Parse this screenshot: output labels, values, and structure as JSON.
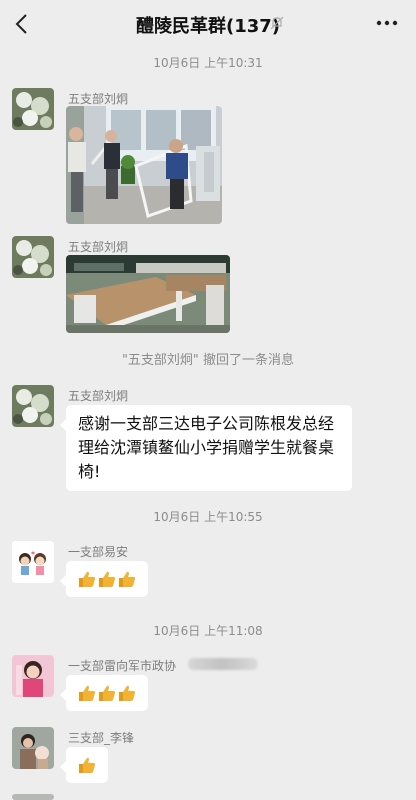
{
  "header": {
    "title": "醴陵民革群(137)"
  },
  "chat": {
    "time1": "10月6日 上午10:31",
    "sender1": "五支部刘炯",
    "sender2": "五支部刘炯",
    "recall": "\"五支部刘炯\" 撤回了一条消息",
    "sender3": "五支部刘炯",
    "message3": "感谢一支部三达电子公司陈根发总经理给沈潭镇鳌仙小学捐赠学生就餐桌椅!",
    "time2": "10月6日 上午10:55",
    "sender4": "一支部易安",
    "time3": "10月6日 上午11:08",
    "sender5": "一支部雷向军市政协",
    "sender6": "三支部_李锋"
  },
  "colors": {
    "background": "#ededed",
    "bubble": "#ffffff",
    "thumb": "#f2b234"
  },
  "icons": [
    "back-icon",
    "mute-icon",
    "more-icon",
    "thumbs-up-icon"
  ]
}
